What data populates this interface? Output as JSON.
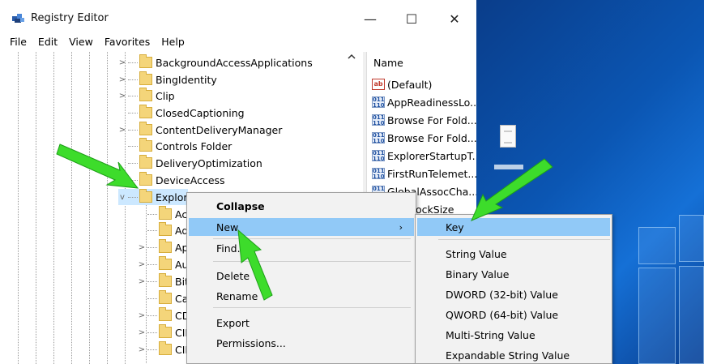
{
  "window": {
    "title": "Registry Editor",
    "minimize": "—",
    "maximize": "☐",
    "close": "✕"
  },
  "menu": [
    "File",
    "Edit",
    "View",
    "Favorites",
    "Help"
  ],
  "tree": {
    "items": [
      {
        "label": "BackgroundAccessApplications",
        "expander": ">"
      },
      {
        "label": "BingIdentity",
        "expander": ">"
      },
      {
        "label": "Clip",
        "expander": ">"
      },
      {
        "label": "ClosedCaptioning",
        "expander": ""
      },
      {
        "label": "ContentDeliveryManager",
        "expander": ">"
      },
      {
        "label": "Controls Folder",
        "expander": ""
      },
      {
        "label": "DeliveryOptimization",
        "expander": ""
      },
      {
        "label": "DeviceAccess",
        "expander": ""
      },
      {
        "label": "Explorer",
        "expander": "v",
        "selected": true
      }
    ],
    "children": [
      {
        "label": "Ac",
        "expander": ""
      },
      {
        "label": "Ad",
        "expander": ""
      },
      {
        "label": "Ap",
        "expander": ">"
      },
      {
        "label": "Au",
        "expander": ">"
      },
      {
        "label": "Bit",
        "expander": ">"
      },
      {
        "label": "Ca",
        "expander": ""
      },
      {
        "label": "CD",
        "expander": ">"
      },
      {
        "label": "CID",
        "expander": ">"
      },
      {
        "label": "CID",
        "expander": ">"
      }
    ]
  },
  "values_pane": {
    "header": "Name",
    "rows": [
      {
        "name": "(Default)",
        "type": "string"
      },
      {
        "name": "AppReadinessLo...",
        "type": "binary"
      },
      {
        "name": "Browse For Fold...",
        "type": "binary"
      },
      {
        "name": "Browse For Fold...",
        "type": "binary"
      },
      {
        "name": "ExplorerStartupT...",
        "type": "binary"
      },
      {
        "name": "FirstRunTelemet...",
        "type": "binary"
      },
      {
        "name": "GlobalAssocCha...",
        "type": "binary"
      },
      {
        "name": "ockSize",
        "type": "binary"
      }
    ]
  },
  "context_menu": {
    "items": [
      {
        "label": "Collapse",
        "bold": true
      },
      {
        "label": "New",
        "submenu": true,
        "highlighted": true
      },
      {
        "label": "Find...",
        "separator_before": true
      },
      {
        "label": "Delete",
        "separator_before": true
      },
      {
        "label": "Rename"
      },
      {
        "label": "Export",
        "separator_before": true
      },
      {
        "label": "Permissions..."
      }
    ]
  },
  "new_submenu": {
    "items": [
      {
        "label": "Key",
        "highlighted": true
      },
      {
        "label": "String Value",
        "separator_before": true
      },
      {
        "label": "Binary Value"
      },
      {
        "label": "DWORD (32-bit) Value"
      },
      {
        "label": "QWORD (64-bit) Value"
      },
      {
        "label": "Multi-String Value"
      },
      {
        "label": "Expandable String Value"
      }
    ]
  },
  "colors": {
    "highlight": "#91c9f7",
    "arrow": "#3ddc2b",
    "desktop": "#0b56b3"
  }
}
